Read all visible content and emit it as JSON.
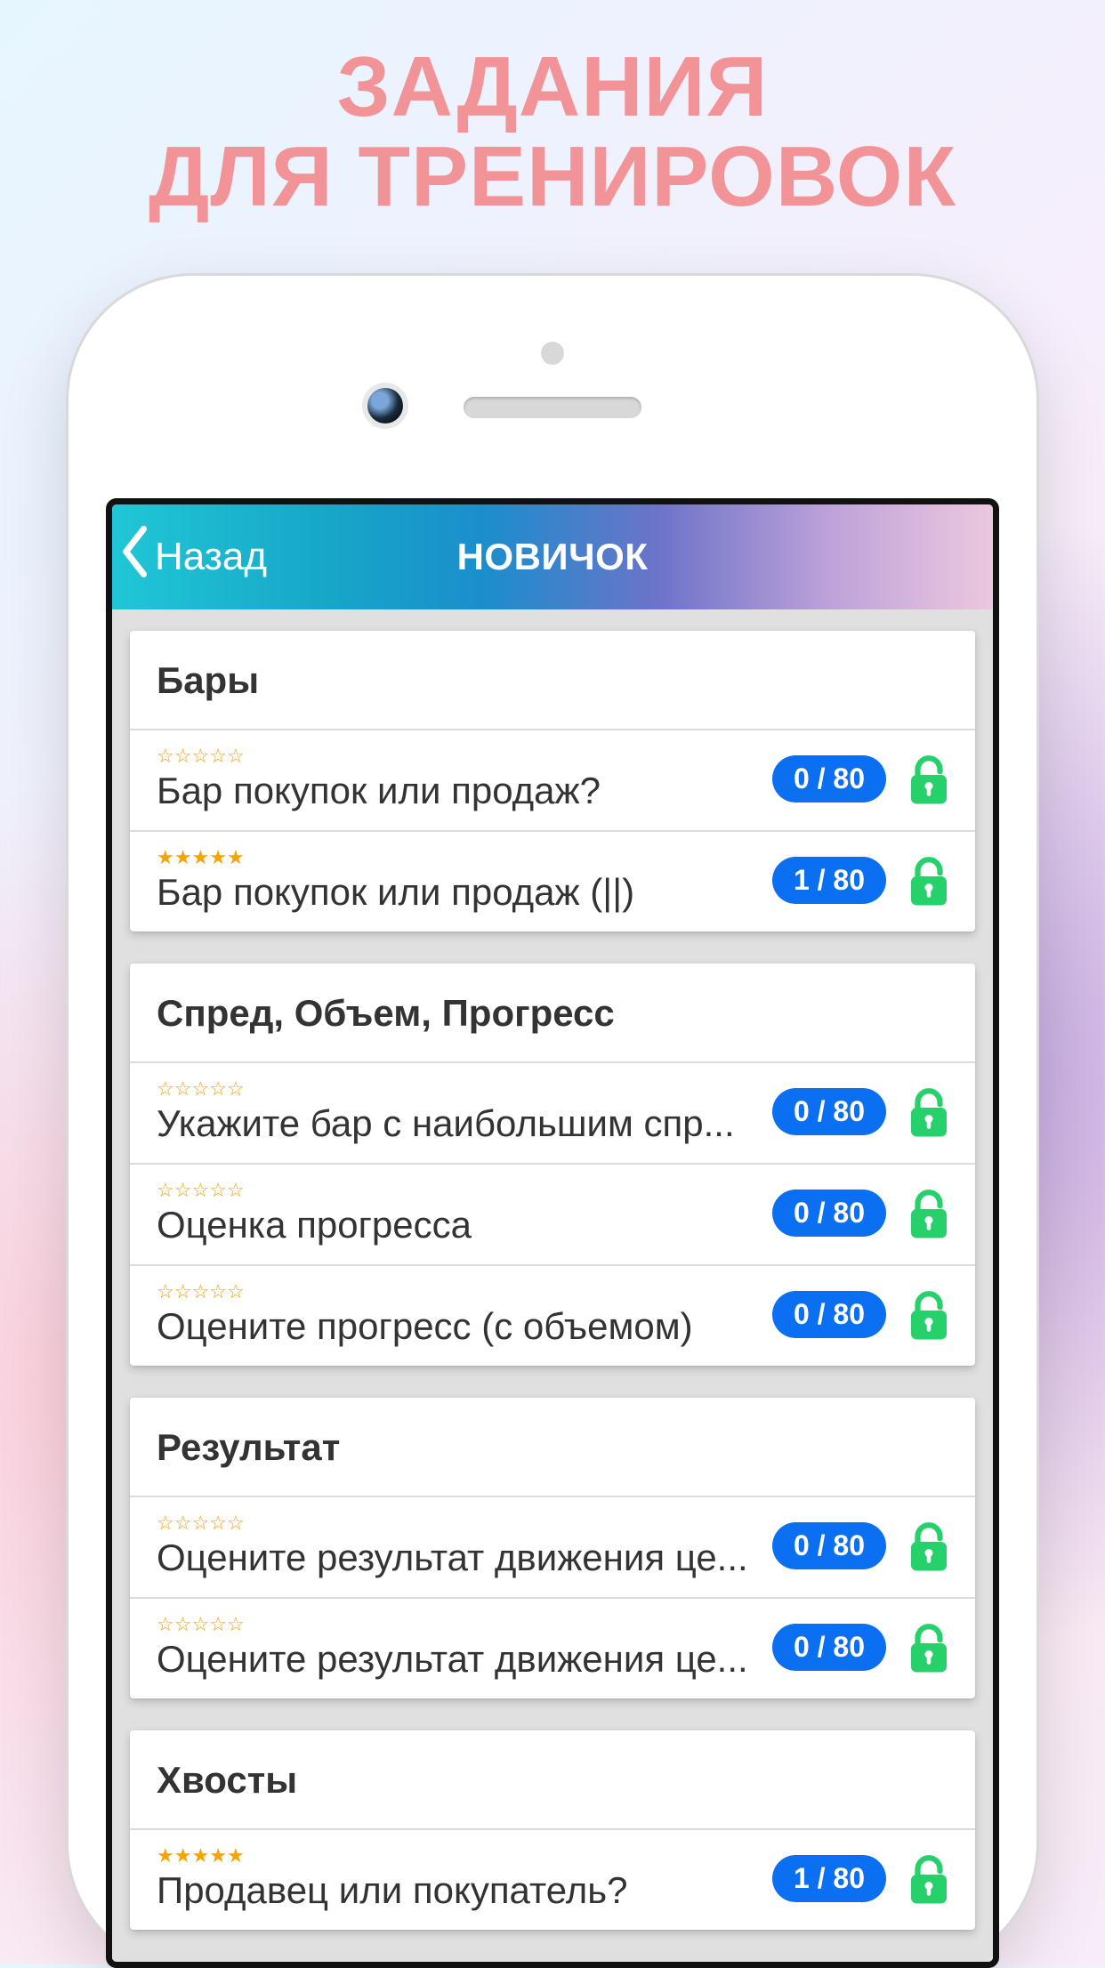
{
  "promo": {
    "line1": "ЗАДАНИЯ",
    "line2": "ДЛЯ ТРЕНИРОВОК"
  },
  "nav": {
    "back_label": "Назад",
    "title": "НОВИЧОК"
  },
  "sections": [
    {
      "title": "Бары",
      "tasks": [
        {
          "title": "Бар покупок или продаж?",
          "rating_filled": 0,
          "rating_total": 5,
          "progress": "0 / 80",
          "unlocked": true
        },
        {
          "title": "Бар покупок или продаж (||)",
          "rating_filled": 5,
          "rating_total": 5,
          "progress": "1 / 80",
          "unlocked": true
        }
      ]
    },
    {
      "title": "Спред, Объем, Прогресс",
      "tasks": [
        {
          "title": "Укажите бар с наибольшим спр...",
          "rating_filled": 0,
          "rating_total": 5,
          "progress": "0 / 80",
          "unlocked": true
        },
        {
          "title": "Оценка прогресса",
          "rating_filled": 0,
          "rating_total": 5,
          "progress": "0 / 80",
          "unlocked": true
        },
        {
          "title": "Оцените прогресс (с объемом)",
          "rating_filled": 0,
          "rating_total": 5,
          "progress": "0 / 80",
          "unlocked": true
        }
      ]
    },
    {
      "title": "Результат",
      "tasks": [
        {
          "title": "Оцените результат движения це...",
          "rating_filled": 0,
          "rating_total": 5,
          "progress": "0 / 80",
          "unlocked": true
        },
        {
          "title": "Оцените результат движения це...",
          "rating_filled": 0,
          "rating_total": 5,
          "progress": "0 / 80",
          "unlocked": true
        }
      ]
    },
    {
      "title": "Хвосты",
      "tasks": [
        {
          "title": "Продавец или покупатель?",
          "rating_filled": 5,
          "rating_total": 5,
          "progress": "1 / 80",
          "unlocked": true
        }
      ]
    }
  ]
}
